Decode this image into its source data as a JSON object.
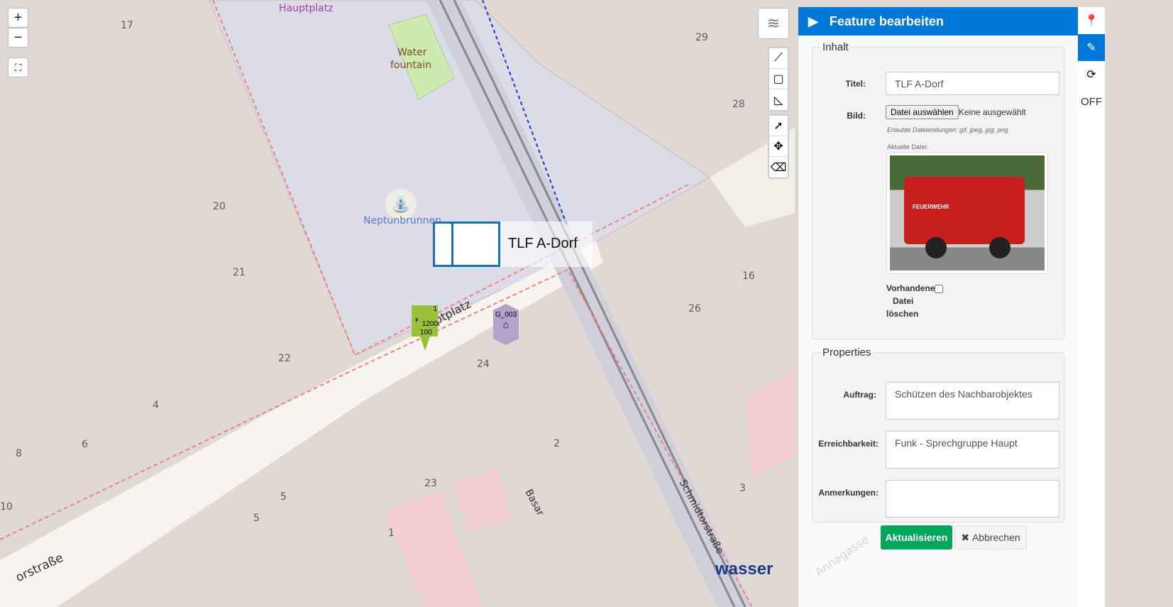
{
  "map": {
    "labels": {
      "hauptplatz_top": "Hauptplatz",
      "water": "Water",
      "fountain": "fountain",
      "neptun": "Neptunbrunnen",
      "street_hauptplatz": "ptplatz",
      "schmidtor": "Schmidtorstraße",
      "basar": "Basar",
      "strasse_left": "orstraße",
      "annagasse": "Annagasse"
    },
    "numbers": [
      "17",
      "20",
      "21",
      "22",
      "4",
      "6",
      "8",
      "5",
      "5",
      "23",
      "1",
      "2",
      "24",
      "26",
      "16",
      "28",
      "29",
      "3",
      "10"
    ],
    "feature_label": "TLF A-Dorf",
    "marker_green": {
      "top": "1",
      "mid": "1200",
      "bottom": "100"
    },
    "marker_purple": "G_003",
    "logo": "wasser"
  },
  "controls": {
    "zoom_in": "+",
    "zoom_out": "−"
  },
  "panel": {
    "title": "Feature bearbeiten",
    "inhalt": {
      "legend": "Inhalt",
      "titel_label": "Titel:",
      "titel_value": "TLF A-Dorf",
      "bild_label": "Bild:",
      "file_button": "Datei auswählen",
      "file_status": "Keine ausgewählt",
      "hint": "Erlaubte Dateiendungen: gif, jpeg, jpg, png",
      "current_file": "Aktuelle Datei:",
      "image_text": "FEUERWEHR",
      "delete_label_1": "Vorhandene",
      "delete_label_2": "Datei",
      "delete_label_3": "löschen"
    },
    "properties": {
      "legend": "Properties",
      "auftrag_label": "Auftrag:",
      "auftrag_value": "Schützen des Nachbarobjektes",
      "erreich_label": "Erreichbarkeit:",
      "erreich_value": "Funk - Sprechgruppe Haupt",
      "anm_label": "Anmerkungen:",
      "anm_value": ""
    },
    "submit": "Aktualisieren",
    "cancel": "Abbrechen"
  },
  "rail": {
    "off": "OFF"
  },
  "colors": {
    "accent": "#0078d7",
    "success": "#00a65a"
  }
}
